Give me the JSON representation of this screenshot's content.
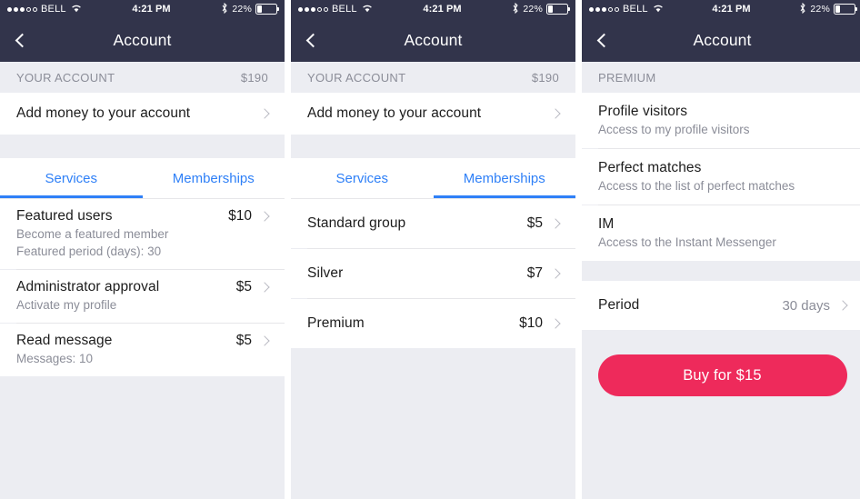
{
  "status_bar": {
    "carrier": "BELL",
    "time": "4:21 PM",
    "battery_percent": "22%",
    "signal_dots_filled": 3,
    "signal_dots_hollow": 2,
    "wifi_icon": "wifi-icon",
    "bluetooth_icon": "bluetooth-icon",
    "battery_icon": "battery-icon"
  },
  "colors": {
    "navbar": "#32344b",
    "accent_blue": "#2f80f7",
    "accent_pink": "#ee2a5b",
    "band_gray": "#ecedf2",
    "text_primary": "#1c1c1c",
    "text_secondary": "#8b8d98"
  },
  "nav": {
    "title": "Account",
    "back_icon": "chevron-left-icon"
  },
  "panel1": {
    "section_header": {
      "label": "YOUR ACCOUNT",
      "amount": "$190"
    },
    "add_money": {
      "label": "Add money to your account",
      "chevron": "chevron-right-icon"
    },
    "tabs": [
      {
        "label": "Services",
        "active": true
      },
      {
        "label": "Memberships",
        "active": false
      }
    ],
    "items": [
      {
        "title": "Featured users",
        "price": "$10",
        "sub1": "Become a featured member",
        "sub2": "Featured period (days): 30"
      },
      {
        "title": "Administrator approval",
        "price": "$5",
        "sub1": "Activate my profile",
        "sub2": ""
      },
      {
        "title": "Read message",
        "price": "$5",
        "sub1": "Messages: 10",
        "sub2": ""
      }
    ]
  },
  "panel2": {
    "section_header": {
      "label": "YOUR ACCOUNT",
      "amount": "$190"
    },
    "add_money": {
      "label": "Add money to your account",
      "chevron": "chevron-right-icon"
    },
    "tabs": [
      {
        "label": "Services",
        "active": false
      },
      {
        "label": "Memberships",
        "active": true
      }
    ],
    "items": [
      {
        "title": "Standard group",
        "price": "$5"
      },
      {
        "title": "Silver",
        "price": "$7"
      },
      {
        "title": "Premium",
        "price": "$10"
      }
    ]
  },
  "panel3": {
    "section_header": {
      "label": "PREMIUM",
      "amount": ""
    },
    "features": [
      {
        "title": "Profile visitors",
        "sub": "Access to my profile visitors"
      },
      {
        "title": "Perfect matches",
        "sub": "Access to the list of perfect matches"
      },
      {
        "title": "IM",
        "sub": "Access to the Instant Messenger"
      }
    ],
    "period": {
      "label": "Period",
      "value": "30 days",
      "chevron": "chevron-right-icon"
    },
    "buy_button": {
      "label": "Buy for $15"
    }
  }
}
